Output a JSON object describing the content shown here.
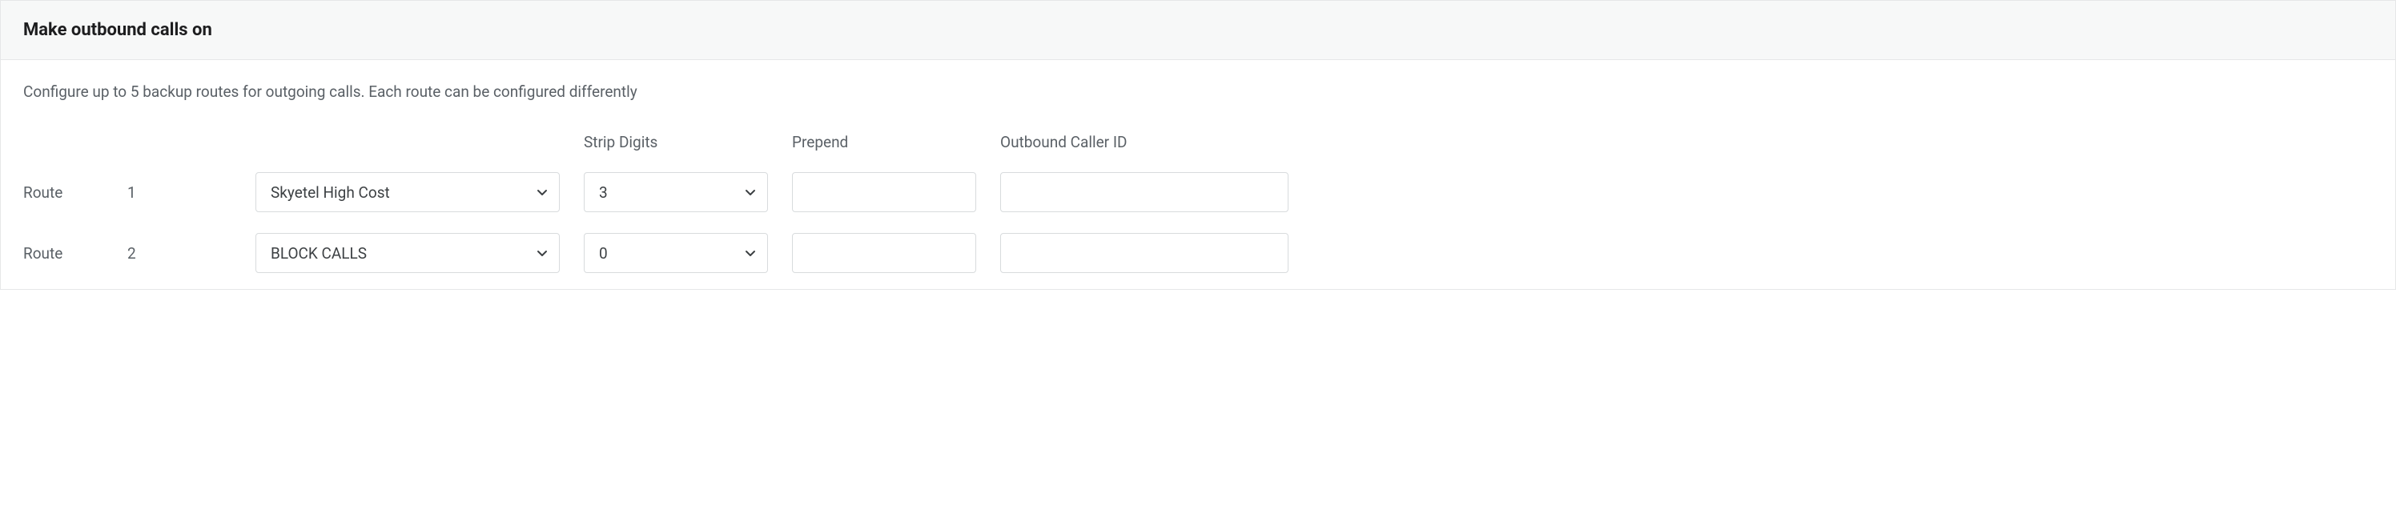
{
  "header": {
    "title": "Make outbound calls on"
  },
  "description": "Configure up to 5 backup routes for outgoing calls. Each route can be configured differently",
  "columns": {
    "route": "Route",
    "strip_digits": "Strip Digits",
    "prepend": "Prepend",
    "outbound_caller_id": "Outbound Caller ID"
  },
  "routes": [
    {
      "num": "1",
      "endpoint": "Skyetel High Cost",
      "strip_digits": "3",
      "prepend": "",
      "caller_id": ""
    },
    {
      "num": "2",
      "endpoint": "BLOCK CALLS",
      "strip_digits": "0",
      "prepend": "",
      "caller_id": ""
    }
  ]
}
